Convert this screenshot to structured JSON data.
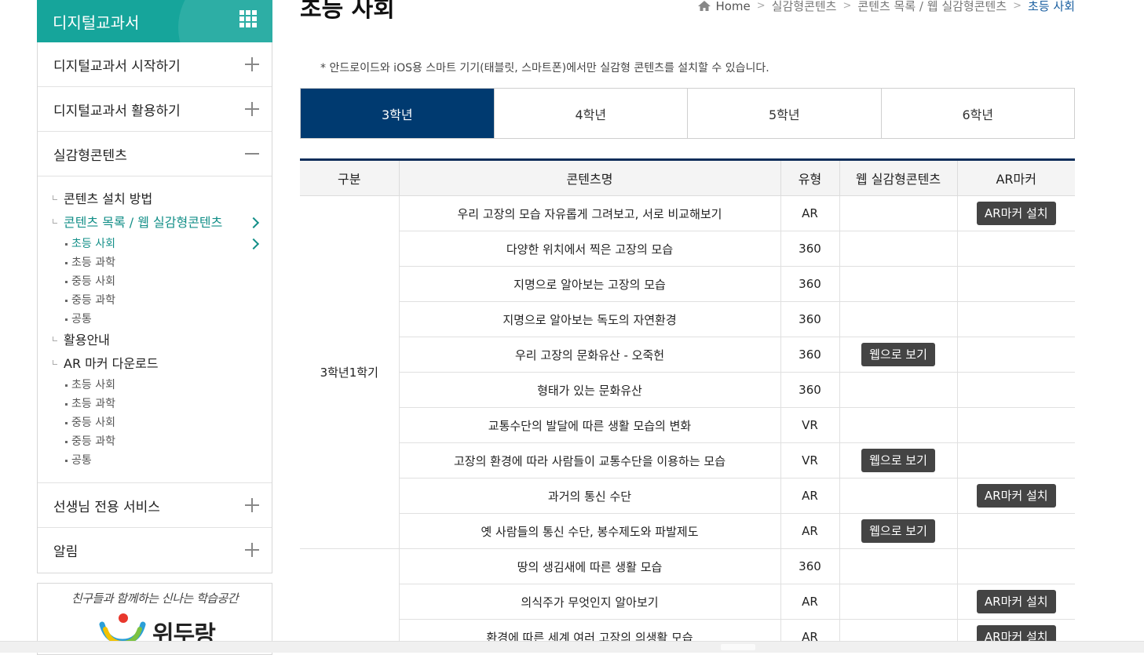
{
  "sidebar": {
    "header_title": "디지털교과서",
    "menu_top": [
      {
        "label": "디지털교과서 시작하기"
      },
      {
        "label": "디지털교과서 활용하기"
      }
    ],
    "open_menu": {
      "label": "실감형콘텐츠",
      "items": [
        {
          "label": "콘텐츠 설치 방법"
        },
        {
          "label": "콘텐츠 목록 / 웹 실감형콘텐츠",
          "sub": [
            "초등 사회",
            "초등 과학",
            "중등 사회",
            "중등 과학",
            "공통"
          ]
        },
        {
          "label": "활용안내"
        },
        {
          "label": "AR 마커 다운로드",
          "sub": [
            "초등 사회",
            "초등 과학",
            "중등 사회",
            "중등 과학",
            "공통"
          ]
        }
      ]
    },
    "menu_bottom": [
      {
        "label": "선생님 전용 서비스"
      },
      {
        "label": "알림"
      }
    ],
    "banner": {
      "slogan": "친구들과 함께하는 신나는 학습공간",
      "logo_text": "위두랑"
    }
  },
  "page": {
    "title": "초등 사회",
    "breadcrumb": [
      "Home",
      "실감형콘텐츠",
      "콘텐츠 목록 / 웹 실감형콘텐츠",
      "초등 사회"
    ],
    "notice": "* 안드로이드와 iOS용 스마트 기기(태블릿, 스마트폰)에서만 실감형 콘텐츠를 설치할 수 있습니다."
  },
  "tabs": [
    "3학년",
    "4학년",
    "5학년",
    "6학년"
  ],
  "table": {
    "headers": [
      "구분",
      "콘텐츠명",
      "유형",
      "웹 실감형콘텐츠",
      "AR마커"
    ],
    "semester1": "3학년1학기",
    "semester2": "",
    "web_btn": "웹으로 보기",
    "ar_btn": "AR마커 설치",
    "rows": [
      {
        "name": "우리 고장의 모습 자유롭게 그려보고, 서로 비교해보기",
        "type": "AR",
        "web": false,
        "ar": true
      },
      {
        "name": "다양한 위치에서 찍은 고장의 모습",
        "type": "360",
        "web": false,
        "ar": false
      },
      {
        "name": "지명으로 알아보는 고장의 모습",
        "type": "360",
        "web": false,
        "ar": false
      },
      {
        "name": "지명으로 알아보는 독도의 자연환경",
        "type": "360",
        "web": false,
        "ar": false
      },
      {
        "name": "우리 고장의 문화유산 - 오죽헌",
        "type": "360",
        "web": true,
        "ar": false
      },
      {
        "name": "형태가 있는 문화유산",
        "type": "360",
        "web": false,
        "ar": false
      },
      {
        "name": "교통수단의 발달에 따른 생활 모습의 변화",
        "type": "VR",
        "web": false,
        "ar": false
      },
      {
        "name": "고장의 환경에 따라 사람들이 교통수단을 이용하는 모습",
        "type": "VR",
        "web": true,
        "ar": false
      },
      {
        "name": "과거의 통신 수단",
        "type": "AR",
        "web": false,
        "ar": true
      },
      {
        "name": "옛 사람들의 통신 수단, 봉수제도와 파발제도",
        "type": "AR",
        "web": true,
        "ar": false
      },
      {
        "name": "땅의 생김새에 따른 생활 모습",
        "type": "360",
        "web": false,
        "ar": false
      },
      {
        "name": "의식주가 무엇인지 알아보기",
        "type": "AR",
        "web": false,
        "ar": true
      },
      {
        "name": "환경에 따른 세계 여러 고장의 의생활 모습",
        "type": "AR",
        "web": false,
        "ar": true
      }
    ]
  }
}
